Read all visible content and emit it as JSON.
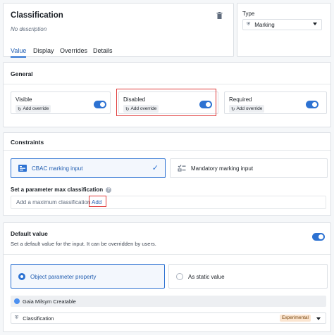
{
  "header": {
    "title": "Classification",
    "description": "No description",
    "tabs": [
      "Value",
      "Display",
      "Overrides",
      "Details"
    ],
    "type_label": "Type",
    "type_value": "Marking"
  },
  "general": {
    "heading": "General",
    "cards": [
      {
        "label": "Visible",
        "override": "Add override",
        "on": true
      },
      {
        "label": "Disabled",
        "override": "Add override",
        "on": true
      },
      {
        "label": "Required",
        "override": "Add override",
        "on": true
      }
    ]
  },
  "constraints": {
    "heading": "Constraints",
    "option_cbac": "CBAC marking input",
    "option_mandatory": "Mandatory marking input",
    "max_heading": "Set a parameter max classification",
    "max_text": "Add a maximum classification",
    "add_link": "Add"
  },
  "default_value": {
    "heading": "Default value",
    "description": "Set a default value for the input. It can be overridden by users.",
    "on": true,
    "option_object": "Object parameter property",
    "option_static": "As static value",
    "object_name": "Gaia Milsym Creatable",
    "property_name": "Classification",
    "property_badge": "Experimental"
  },
  "colors": {
    "accent": "#2d72d2",
    "highlight": "#e03c3c"
  }
}
